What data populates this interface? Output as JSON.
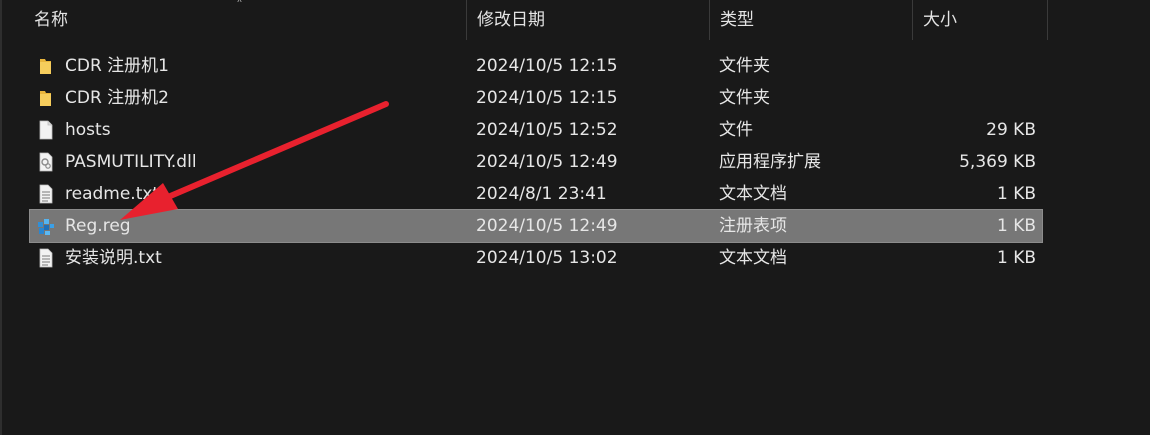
{
  "header": {
    "columns": [
      {
        "label": "名称"
      },
      {
        "label": "修改日期"
      },
      {
        "label": "类型"
      },
      {
        "label": "大小"
      }
    ],
    "sort_indicator": "chevron-up-icon"
  },
  "files": [
    {
      "name": "CDR 注册机1",
      "date": "2024/10/5 12:15",
      "type": "文件夹",
      "size": "",
      "icon": "folder-icon",
      "selected": false
    },
    {
      "name": "CDR 注册机2",
      "date": "2024/10/5 12:15",
      "type": "文件夹",
      "size": "",
      "icon": "folder-icon",
      "selected": false
    },
    {
      "name": "hosts",
      "date": "2024/10/5 12:52",
      "type": "文件",
      "size": "29 KB",
      "icon": "blank-file-icon",
      "selected": false
    },
    {
      "name": "PASMUTILITY.dll",
      "date": "2024/10/5 12:49",
      "type": "应用程序扩展",
      "size": "5,369 KB",
      "icon": "dll-file-icon",
      "selected": false
    },
    {
      "name": "readme.txt",
      "date": "2024/8/1 23:41",
      "type": "文本文档",
      "size": "1 KB",
      "icon": "text-file-icon",
      "selected": false
    },
    {
      "name": "Reg.reg",
      "date": "2024/10/5 12:49",
      "type": "注册表项",
      "size": "1 KB",
      "icon": "registry-file-icon",
      "selected": true
    },
    {
      "name": "安装说明.txt",
      "date": "2024/10/5 13:02",
      "type": "文本文档",
      "size": "1 KB",
      "icon": "text-file-icon",
      "selected": false
    }
  ],
  "colors": {
    "background": "#191919",
    "selection": "#777777",
    "arrow": "#e8212e",
    "folder": "#f2c14e"
  }
}
